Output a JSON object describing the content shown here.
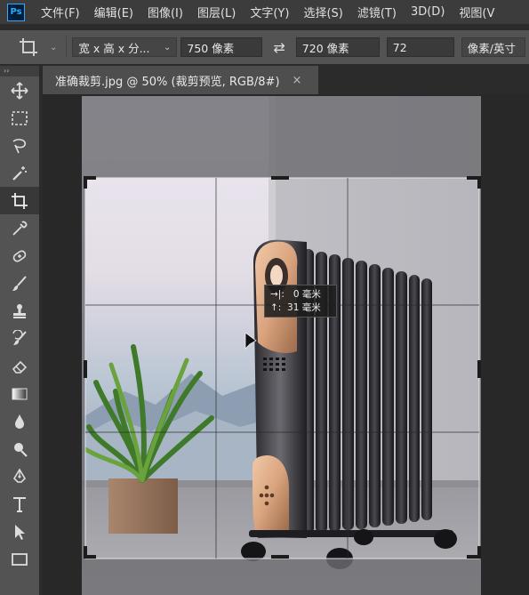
{
  "menu": {
    "logo": "Ps",
    "items": [
      "文件(F)",
      "编辑(E)",
      "图像(I)",
      "图层(L)",
      "文字(Y)",
      "选择(S)",
      "滤镜(T)",
      "3D(D)",
      "视图(V"
    ]
  },
  "options": {
    "ratio_preset": "宽 x 高 x 分...",
    "width_value": "750 像素",
    "height_value": "720 像素",
    "resolution_value": "72",
    "resolution_unit": "像素/英寸"
  },
  "toolbar": {
    "collapse": "››",
    "tools": [
      "move-tool",
      "marquee-tool",
      "lasso-tool",
      "magic-wand-tool",
      "crop-tool",
      "eyedropper-tool",
      "healing-brush-tool",
      "brush-tool",
      "clone-stamp-tool",
      "history-brush-tool",
      "eraser-tool",
      "gradient-tool",
      "blur-tool",
      "dodge-tool",
      "pen-tool",
      "type-tool",
      "path-selection-tool",
      "rectangle-tool"
    ],
    "active": "crop-tool"
  },
  "document": {
    "tab_title": "准确裁剪.jpg @ 50% (裁剪预览, RGB/8#)",
    "close": "×"
  },
  "crop_tooltip": {
    "line1": "→|:   0 毫米",
    "line2": "↑:  31 毫米"
  },
  "colors": {
    "menubar": "#3c3c3c",
    "panel": "#535353",
    "canvas_bg": "#282828",
    "crop_overlay": "#6c6c72",
    "ps_blue": "#31a8ff",
    "heater_copper": "#d9a47e"
  }
}
